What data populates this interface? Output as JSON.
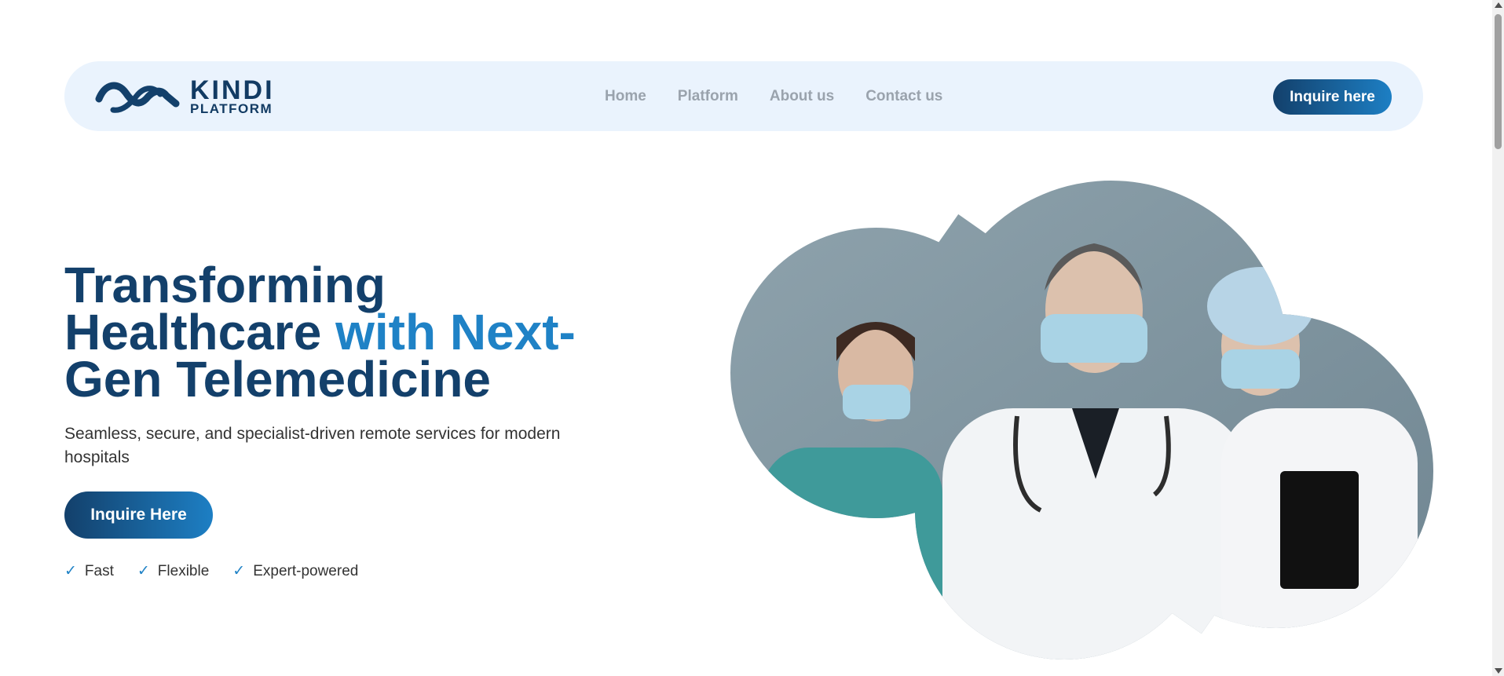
{
  "nav": {
    "logo_word": "KINDI",
    "logo_sub": "PLATFORM",
    "links": [
      "Home",
      "Platform",
      "About us",
      "Contact us"
    ],
    "cta": "Inquire here"
  },
  "hero": {
    "title_line1": "Transforming",
    "title_line2a": "Healthcare ",
    "title_line2b": "with Next-",
    "title_line3": "Gen Telemedicine",
    "subtitle": "Seamless, secure, and specialist-driven remote services for modern hospitals",
    "cta": "Inquire Here",
    "features": [
      "Fast",
      "Flexible",
      "Expert-powered"
    ],
    "image_icon": "doctors-photo"
  },
  "colors": {
    "brand_dark": "#13406b",
    "brand_light": "#1f82c6",
    "nav_bg": "#eaf3fd"
  }
}
